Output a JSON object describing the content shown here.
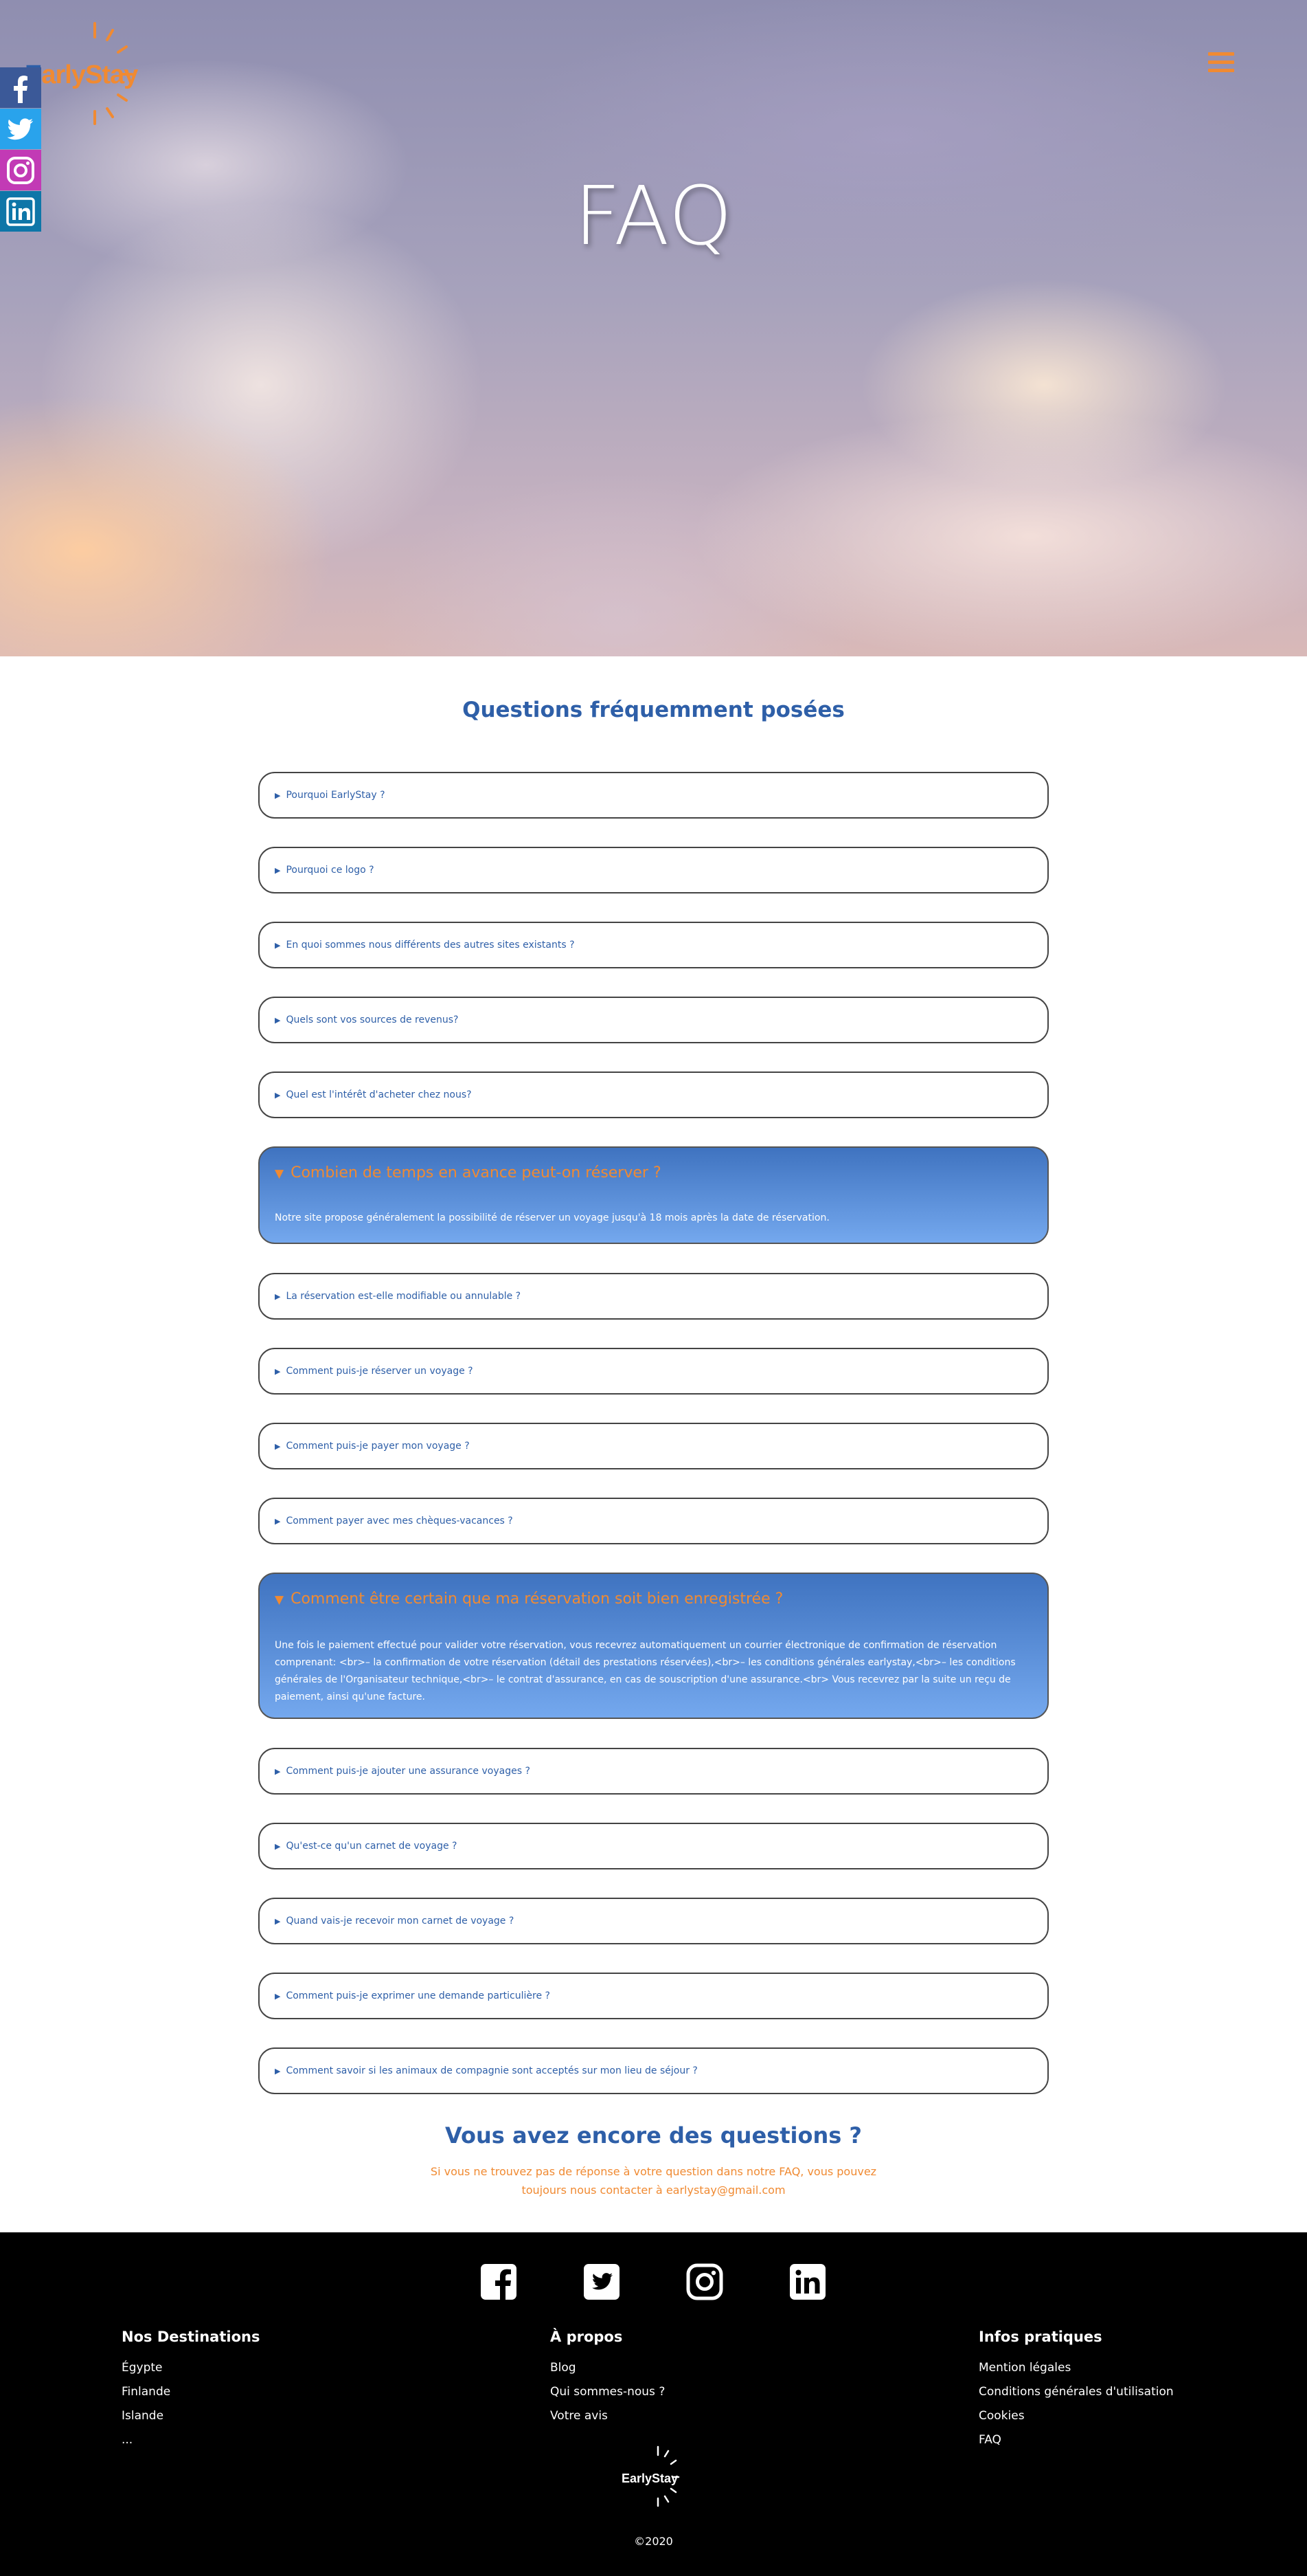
{
  "header": {
    "logo_first": "E",
    "logo_rest": "arlyStay",
    "menu_icon": "hamburger-menu-icon",
    "hero_title": "FAQ"
  },
  "social_sidebar": [
    {
      "name": "facebook",
      "icon": "facebook-icon"
    },
    {
      "name": "twitter",
      "icon": "twitter-icon"
    },
    {
      "name": "instagram",
      "icon": "instagram-icon"
    },
    {
      "name": "linkedin",
      "icon": "linkedin-icon"
    }
  ],
  "faq": {
    "title": "Questions fréquemment posées",
    "items": [
      {
        "question": "Pourquoi EarlyStay ?",
        "open": false
      },
      {
        "question": "Pourquoi ce logo ?",
        "open": false
      },
      {
        "question": "En quoi sommes nous différents des autres sites existants ?",
        "open": false
      },
      {
        "question": "Quels sont vos sources de revenus?",
        "open": false
      },
      {
        "question": "Quel est l'intérêt d'acheter chez nous?",
        "open": false
      },
      {
        "question": "Combien de temps en avance peut-on réserver ?",
        "open": true,
        "answer": "Notre site propose généralement la possibilité de réserver un voyage jusqu'à 18 mois après la date de réservation."
      },
      {
        "question": "La réservation est-elle modifiable ou annulable ?",
        "open": false
      },
      {
        "question": "Comment puis-je réserver un voyage ?",
        "open": false
      },
      {
        "question": "Comment puis-je payer mon voyage ?",
        "open": false
      },
      {
        "question": "Comment payer avec mes chèques-vacances ?",
        "open": false
      },
      {
        "question": "Comment être certain que ma réservation soit bien enregistrée ?",
        "open": true,
        "answer": "Une fois le paiement effectué pour valider votre réservation, vous recevrez automatiquement un courrier électronique de confirmation de réservation comprenant: <br>– la confirmation de votre réservation (détail des prestations réservées),<br>– les conditions générales earlystay,<br>– les conditions générales de l'Organisateur technique,<br>– le contrat d'assurance, en cas de souscription d'une assurance.<br> Vous recevrez par la suite un reçu de paiement, ainsi qu'une facture."
      },
      {
        "question": "Comment puis-je ajouter une assurance voyages ?",
        "open": false
      },
      {
        "question": "Qu'est-ce qu'un carnet de voyage ?",
        "open": false
      },
      {
        "question": "Quand vais-je recevoir mon carnet de voyage ?",
        "open": false
      },
      {
        "question": "Comment puis-je exprimer une demande particulière ?",
        "open": false
      },
      {
        "question": "Comment savoir si les animaux de compagnie sont acceptés sur mon lieu de séjour ?",
        "open": false
      }
    ]
  },
  "contact": {
    "title": "Vous avez encore des questions ?",
    "text": "Si vous ne trouvez pas de réponse à votre question dans notre FAQ, vous pouvez toujours nous contacter à earlystay@gmail.com"
  },
  "footer": {
    "social_icons": [
      "facebook-icon",
      "twitter-icon",
      "instagram-icon",
      "linkedin-icon"
    ],
    "columns": [
      {
        "title": "Nos Destinations",
        "links": [
          "Égypte",
          "Finlande",
          "Islande",
          "..."
        ]
      },
      {
        "title": "À propos",
        "links": [
          "Blog",
          "Qui sommes-nous ?",
          "Votre avis"
        ]
      },
      {
        "title": "Infos pratiques",
        "links": [
          "Mention légales",
          "Conditions générales d'utilisation",
          "Cookies",
          "FAQ"
        ]
      }
    ],
    "logo_text": "EarlyStay",
    "copyright": "©2020"
  },
  "colors": {
    "primary_blue": "#2e5fa8",
    "accent_orange": "#f08a32",
    "footer_bg": "#000000"
  }
}
